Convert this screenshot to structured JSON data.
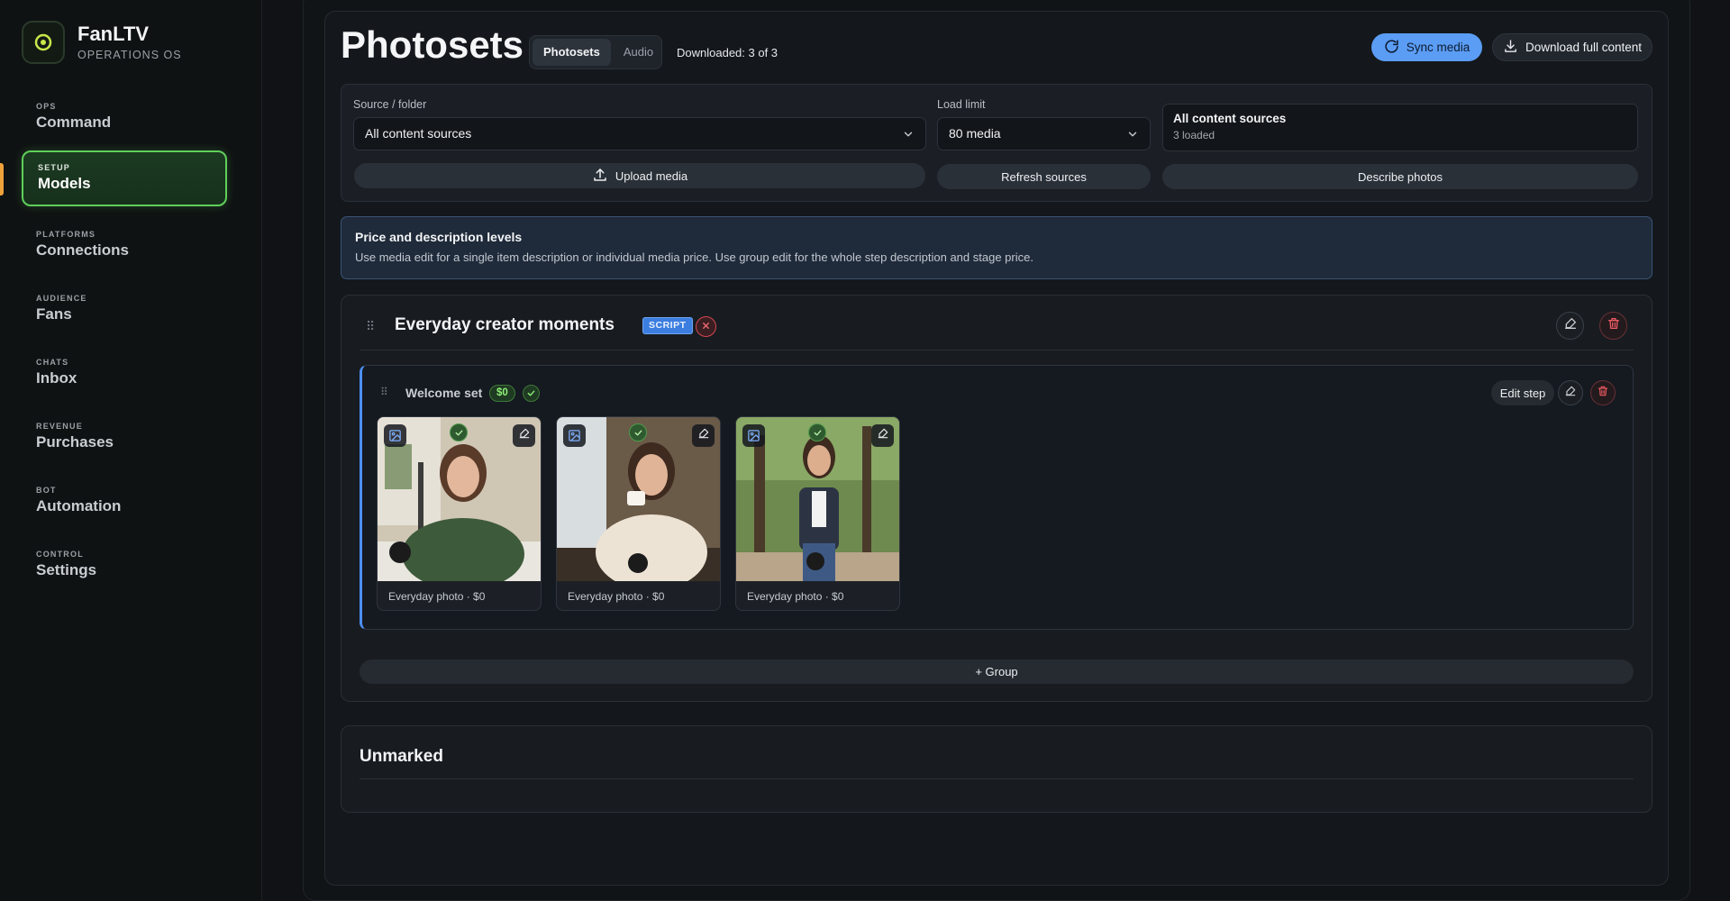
{
  "brand": {
    "name": "FanLTV",
    "subtitle": "OPERATIONS OS"
  },
  "sidebar": {
    "items": [
      {
        "kicker": "OPS",
        "label": "Command"
      },
      {
        "kicker": "SETUP",
        "label": "Models",
        "active": true
      },
      {
        "kicker": "PLATFORMS",
        "label": "Connections"
      },
      {
        "kicker": "AUDIENCE",
        "label": "Fans"
      },
      {
        "kicker": "CHATS",
        "label": "Inbox"
      },
      {
        "kicker": "REVENUE",
        "label": "Purchases"
      },
      {
        "kicker": "BOT",
        "label": "Automation"
      },
      {
        "kicker": "CONTROL",
        "label": "Settings"
      }
    ]
  },
  "header": {
    "title": "Photosets",
    "tabs": [
      "Photosets",
      "Audio"
    ],
    "active_tab": "Photosets",
    "downloaded": "Downloaded: 3 of 3",
    "sync_label": "Sync media",
    "download_label": "Download full content"
  },
  "controls": {
    "source_label": "Source / folder",
    "source_value": "All content sources",
    "limit_label": "Load limit",
    "limit_value": "80 media",
    "summary_title": "All content sources",
    "summary_sub": "3 loaded",
    "upload_label": "Upload media",
    "refresh_label": "Refresh sources",
    "describe_label": "Describe photos"
  },
  "info": {
    "title": "Price and description levels",
    "text": "Use media edit for a single item description or individual media price. Use group edit for the whole step description and stage price."
  },
  "script": {
    "title": "Everyday creator moments",
    "badge": "SCRIPT",
    "group": {
      "title": "Welcome set",
      "price": "$0",
      "edit_step_label": "Edit step",
      "media": [
        {
          "caption": "Everyday photo · $0"
        },
        {
          "caption": "Everyday photo · $0"
        },
        {
          "caption": "Everyday photo · $0"
        }
      ]
    },
    "add_group_label": "+ Group"
  },
  "unmarked": {
    "title": "Unmarked"
  },
  "colors": {
    "accent_green": "#5fcf5a",
    "accent_blue": "#5b9df5",
    "danger": "#d5474f",
    "active_marker": "#f0a23a"
  },
  "icons": {
    "brand": "logo-icon",
    "sync": "refresh-icon",
    "download": "download-icon",
    "upload": "upload-icon",
    "chevron": "chevron-down-icon",
    "edit": "edit-icon",
    "delete": "trash-icon",
    "remove": "close-icon",
    "check": "check-icon",
    "image": "image-icon",
    "drag": "drag-handle-icon"
  }
}
